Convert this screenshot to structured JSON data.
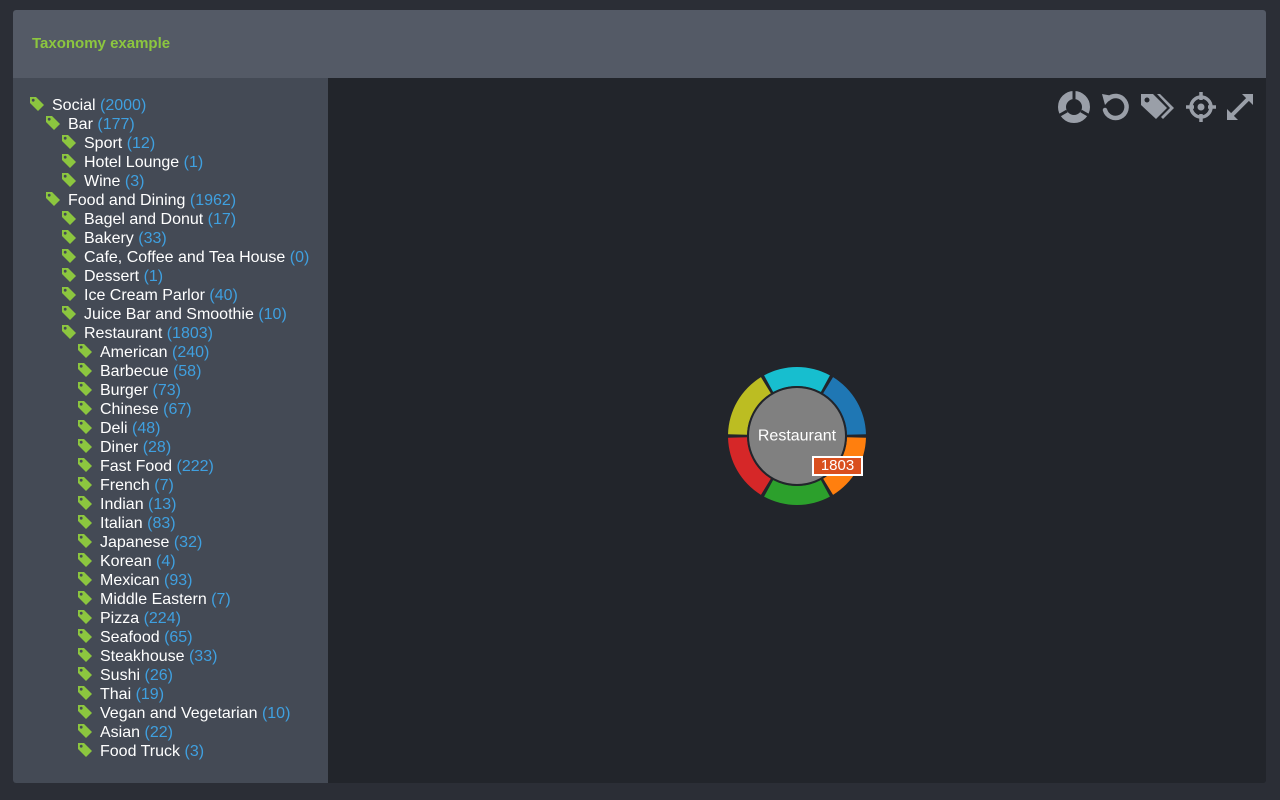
{
  "header": {
    "title": "Taxonomy example"
  },
  "toolbar": {
    "icons": [
      {
        "name": "radial-chart-icon"
      },
      {
        "name": "reset-icon"
      },
      {
        "name": "tags-icon"
      },
      {
        "name": "center-target-icon"
      },
      {
        "name": "expand-icon"
      }
    ]
  },
  "tree": [
    {
      "label": "Social",
      "count": "(2000)",
      "level": 0
    },
    {
      "label": "Bar",
      "count": "(177)",
      "level": 1
    },
    {
      "label": "Sport",
      "count": "(12)",
      "level": 2
    },
    {
      "label": "Hotel Lounge",
      "count": "(1)",
      "level": 2
    },
    {
      "label": "Wine",
      "count": "(3)",
      "level": 2
    },
    {
      "label": "Food and Dining",
      "count": "(1962)",
      "level": 1
    },
    {
      "label": "Bagel and Donut",
      "count": "(17)",
      "level": 2
    },
    {
      "label": "Bakery",
      "count": "(33)",
      "level": 2
    },
    {
      "label": "Cafe, Coffee and Tea House",
      "count": "(0)",
      "level": 2
    },
    {
      "label": "Dessert",
      "count": "(1)",
      "level": 2
    },
    {
      "label": "Ice Cream Parlor",
      "count": "(40)",
      "level": 2
    },
    {
      "label": "Juice Bar and Smoothie",
      "count": "(10)",
      "level": 2
    },
    {
      "label": "Restaurant",
      "count": "(1803)",
      "level": 2
    },
    {
      "label": "American",
      "count": "(240)",
      "level": 3
    },
    {
      "label": "Barbecue",
      "count": "(58)",
      "level": 3
    },
    {
      "label": "Burger",
      "count": "(73)",
      "level": 3
    },
    {
      "label": "Chinese",
      "count": "(67)",
      "level": 3
    },
    {
      "label": "Deli",
      "count": "(48)",
      "level": 3
    },
    {
      "label": "Diner",
      "count": "(28)",
      "level": 3
    },
    {
      "label": "Fast Food",
      "count": "(222)",
      "level": 3
    },
    {
      "label": "French",
      "count": "(7)",
      "level": 3
    },
    {
      "label": "Indian",
      "count": "(13)",
      "level": 3
    },
    {
      "label": "Italian",
      "count": "(83)",
      "level": 3
    },
    {
      "label": "Japanese",
      "count": "(32)",
      "level": 3
    },
    {
      "label": "Korean",
      "count": "(4)",
      "level": 3
    },
    {
      "label": "Mexican",
      "count": "(93)",
      "level": 3
    },
    {
      "label": "Middle Eastern",
      "count": "(7)",
      "level": 3
    },
    {
      "label": "Pizza",
      "count": "(224)",
      "level": 3
    },
    {
      "label": "Seafood",
      "count": "(65)",
      "level": 3
    },
    {
      "label": "Steakhouse",
      "count": "(33)",
      "level": 3
    },
    {
      "label": "Sushi",
      "count": "(26)",
      "level": 3
    },
    {
      "label": "Thai",
      "count": "(19)",
      "level": 3
    },
    {
      "label": "Vegan and Vegetarian",
      "count": "(10)",
      "level": 3
    },
    {
      "label": "Asian",
      "count": "(22)",
      "level": 3
    },
    {
      "label": "Food Truck",
      "count": "(3)",
      "level": 3
    }
  ],
  "chart": {
    "center_label": "Restaurant",
    "badge_value": "1803",
    "center_color": "#808080",
    "segments": [
      {
        "color": "#1f77b4"
      },
      {
        "color": "#ff7f0e"
      },
      {
        "color": "#2ca02c"
      },
      {
        "color": "#d62728"
      },
      {
        "color": "#bcbd22"
      },
      {
        "color": "#17becf"
      }
    ]
  },
  "colors": {
    "accent_green": "#8cc63f",
    "count_blue": "#3fa0e0",
    "badge_orange": "#d94f1e"
  }
}
